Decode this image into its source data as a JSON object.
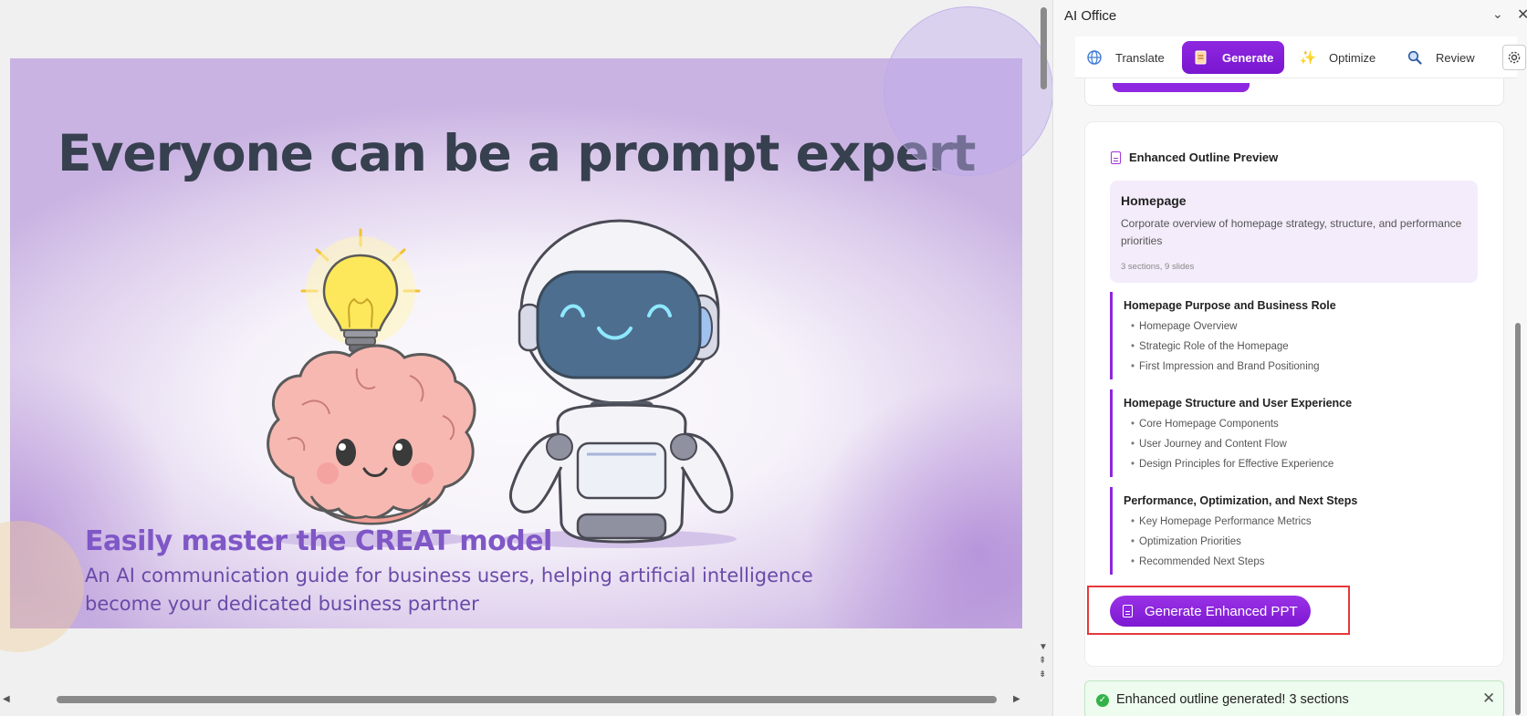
{
  "slide": {
    "title": "Everyone can be a prompt expert",
    "subtitle": "Easily master the CREAT model",
    "body": "An AI communication guide for business users, helping artificial intelligence become your dedicated business partner"
  },
  "panel": {
    "title": "AI Office",
    "tabs": [
      {
        "label": "Translate",
        "icon": "globe-icon"
      },
      {
        "label": "Generate",
        "icon": "document-icon",
        "active": true
      },
      {
        "label": "Optimize",
        "icon": "sparkle-icon"
      },
      {
        "label": "Review",
        "icon": "magnifier-icon"
      }
    ],
    "settings_icon": "gear-icon"
  },
  "outline": {
    "heading": "Enhanced Outline Preview",
    "summary": {
      "title": "Homepage",
      "description": "Corporate overview of homepage strategy, structure, and performance priorities",
      "meta": "3 sections, 9 slides"
    },
    "sections": [
      {
        "title": "Homepage Purpose and Business Role",
        "items": [
          "Homepage Overview",
          "Strategic Role of the Homepage",
          "First Impression and Brand Positioning"
        ]
      },
      {
        "title": "Homepage Structure and User Experience",
        "items": [
          "Core Homepage Components",
          "User Journey and Content Flow",
          "Design Principles for Effective Experience"
        ]
      },
      {
        "title": "Performance, Optimization, and Next Steps",
        "items": [
          "Key Homepage Performance Metrics",
          "Optimization Priorities",
          "Recommended Next Steps"
        ]
      }
    ],
    "generate_button": "Generate Enhanced PPT"
  },
  "toast": {
    "message": "Enhanced outline generated! 3 sections",
    "icon": "check-circle-icon"
  },
  "colors": {
    "accent": "#8e27e0",
    "title": "#37404f",
    "subtitle": "#7f57c6",
    "success": "#34b24a",
    "highlight": "#e5383b"
  }
}
